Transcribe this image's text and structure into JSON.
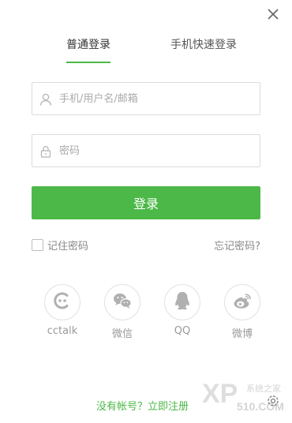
{
  "tabs": [
    {
      "label": "普通登录",
      "active": true
    },
    {
      "label": "手机快速登录",
      "active": false
    }
  ],
  "username": {
    "placeholder": "手机/用户名/邮箱",
    "value": "",
    "icon": "user-icon"
  },
  "password": {
    "placeholder": "密码",
    "value": "",
    "icon": "lock-icon"
  },
  "login_button": "登录",
  "remember": {
    "label": "记住密码",
    "checked": false
  },
  "forgot": "忘记密码?",
  "social": [
    {
      "name": "cctalk",
      "icon": "cctalk-icon"
    },
    {
      "name": "微信",
      "icon": "wechat-icon"
    },
    {
      "name": "QQ",
      "icon": "qq-icon"
    },
    {
      "name": "微博",
      "icon": "weibo-icon"
    }
  ],
  "register": "没有帐号？立即注册",
  "watermark": {
    "brand": "XP",
    "site": "系统之家",
    "domain": "510.COM"
  },
  "colors": {
    "accent": "#4cb848",
    "border": "#dcdcdc",
    "muted": "#999999"
  }
}
